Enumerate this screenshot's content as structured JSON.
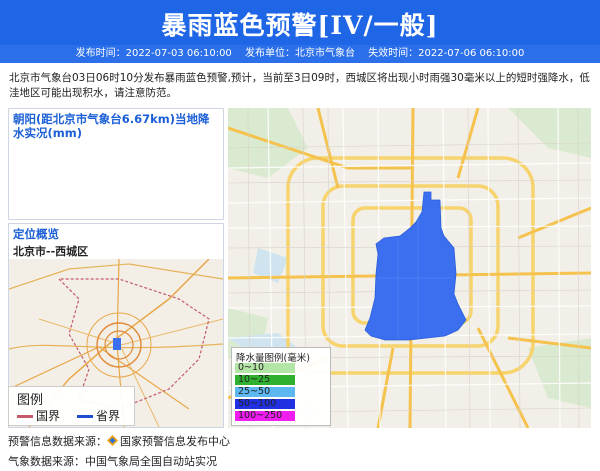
{
  "header": {
    "title": "暴雨蓝色预警[IV/一般]",
    "issue_time": "发布时间：2022-07-03 06:10:00",
    "issuer": "发布单位：北京市气象台",
    "expire_time": "失效时间：2022-07-06 06:10:00"
  },
  "description": "北京市气象台03日06时10分发布暴雨蓝色预警,预计，当前至3日09时，西城区将出现小时雨强30毫米以上的短时强降水，低洼地区可能出现积水，请注意防范。",
  "rain_panel": {
    "title": "朝阳(距北京市气象台6.67km)当地降水实况(mm)"
  },
  "location_panel": {
    "title": "定位概览",
    "subtitle": "北京市--西城区"
  },
  "small_legend": {
    "title": "图例",
    "items": [
      {
        "label": "国界",
        "color": "#c45a6a"
      },
      {
        "label": "省界",
        "color": "#1f4fd0"
      }
    ]
  },
  "precip_legend": {
    "title": "降水量图例(毫米)",
    "items": [
      {
        "label": "0~10",
        "color": "#b3e6a6"
      },
      {
        "label": "10~25",
        "color": "#2fb02f"
      },
      {
        "label": "25~50",
        "color": "#5db7f0"
      },
      {
        "label": "50~100",
        "color": "#2130e0"
      },
      {
        "label": "100~250",
        "color": "#f01df0"
      }
    ]
  },
  "footer": {
    "warning_source": "预警信息数据来源：",
    "warning_source_name": "国家预警信息发布中心",
    "weather_source": "气象数据来源：中国气象局全国自动站实况"
  },
  "colors": {
    "header_blue": "#1f66e6",
    "warning_area": "#3b6ff0"
  }
}
